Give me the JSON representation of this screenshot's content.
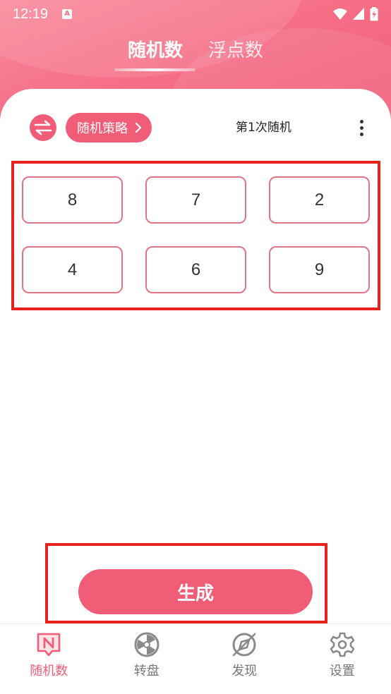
{
  "status_bar": {
    "time": "12:19",
    "notification_icon": "a-badge-icon",
    "icons": [
      "wifi-icon",
      "signal-icon",
      "battery-icon"
    ]
  },
  "top_tabs": [
    {
      "label": "随机数",
      "active": true
    },
    {
      "label": "浮点数",
      "active": false
    }
  ],
  "toolbar": {
    "swap_icon": "swap-arrows-icon",
    "strategy_label": "随机策略",
    "round_label": "第1次随机",
    "more_icon": "more-vertical-icon"
  },
  "numbers": [
    "8",
    "7",
    "2",
    "4",
    "6",
    "9"
  ],
  "generate_label": "生成",
  "bottom_nav": [
    {
      "label": "随机数",
      "icon": "n-badge-icon",
      "active": true
    },
    {
      "label": "转盘",
      "icon": "wheel-icon",
      "active": false
    },
    {
      "label": "发现",
      "icon": "compass-icon",
      "active": false
    },
    {
      "label": "设置",
      "icon": "gear-icon",
      "active": false
    }
  ],
  "colors": {
    "accent": "#f15c77",
    "cell_border": "#e07588",
    "highlight_box": "#e8211d"
  }
}
